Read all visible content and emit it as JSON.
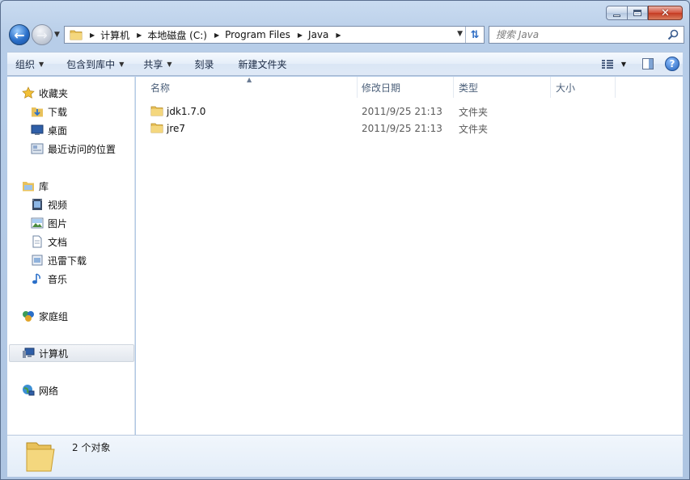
{
  "window": {
    "caption": {
      "minimize": "—",
      "maximize": "□",
      "close": "✕"
    }
  },
  "nav": {
    "back_icon": "arrow-left-icon",
    "forward_icon": "arrow-right-icon",
    "breadcrumbs": [
      "计算机",
      "本地磁盘 (C:)",
      "Program Files",
      "Java"
    ],
    "search_placeholder": "搜索 Java"
  },
  "toolbar": {
    "organize": "组织",
    "include_in_library": "包含到库中",
    "share": "共享",
    "burn": "刻录",
    "new_folder": "新建文件夹",
    "help": "?"
  },
  "sidebar": {
    "favorites": {
      "label": "收藏夹",
      "items": [
        "下载",
        "桌面",
        "最近访问的位置"
      ]
    },
    "libraries": {
      "label": "库",
      "items": [
        "视频",
        "图片",
        "文档",
        "迅雷下载",
        "音乐"
      ]
    },
    "homegroup": "家庭组",
    "computer": "计算机",
    "network": "网络"
  },
  "columns": [
    "名称",
    "修改日期",
    "类型",
    "大小"
  ],
  "files": [
    {
      "name": "jdk1.7.0",
      "date": "2011/9/25 21:13",
      "type": "文件夹",
      "size": ""
    },
    {
      "name": "jre7",
      "date": "2011/9/25 21:13",
      "type": "文件夹",
      "size": ""
    }
  ],
  "status": {
    "count": "2 个对象"
  },
  "colors": {
    "folder": "#e8c15a",
    "accent": "#2a6fc9",
    "window": "#b7cde8"
  }
}
